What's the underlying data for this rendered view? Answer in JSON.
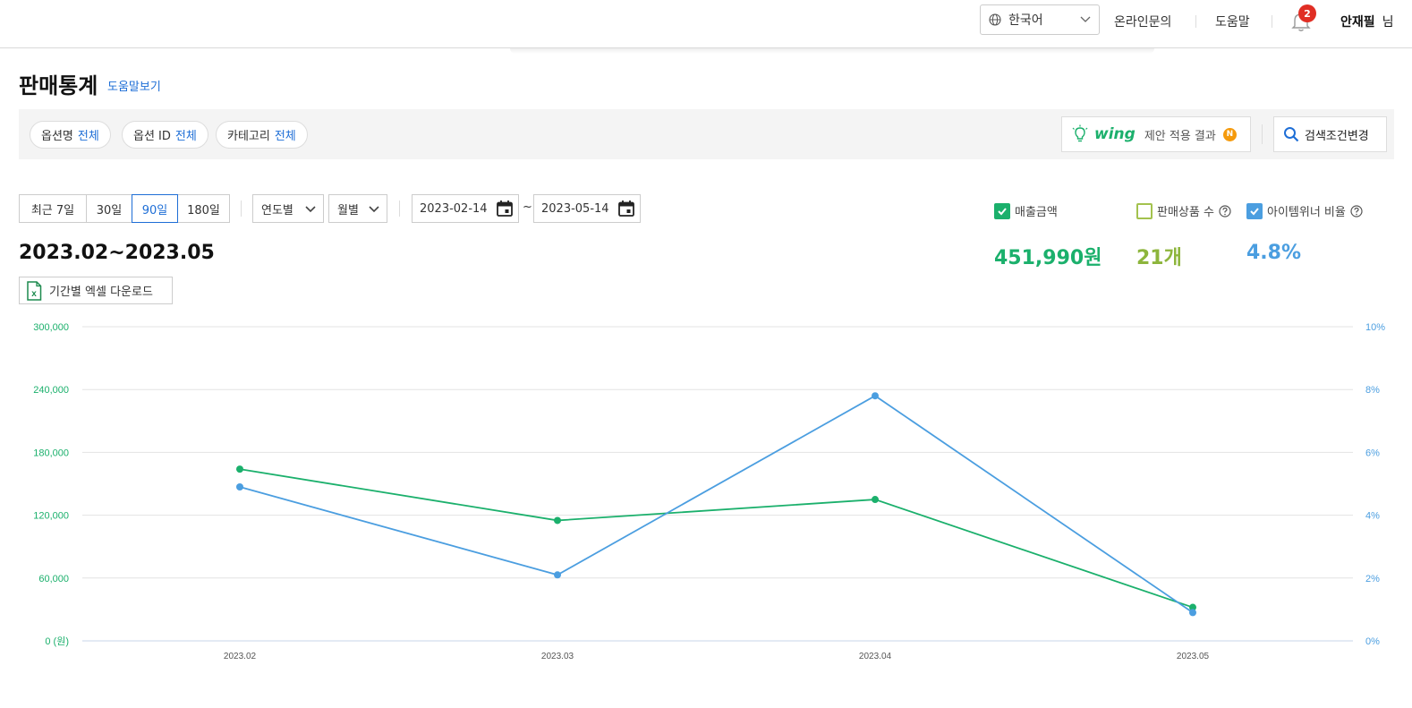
{
  "topbar": {
    "language": "한국어",
    "online_inquiry": "온라인문의",
    "help": "도움말",
    "notification_count": "2",
    "user_name": "안재필",
    "user_suffix": "님"
  },
  "page": {
    "title": "판매통계",
    "help_link": "도움말보기"
  },
  "filters": {
    "option_name_label": "옵션명",
    "option_name_value": "전체",
    "option_id_label": "옵션 ID",
    "option_id_value": "전체",
    "category_label": "카테고리",
    "category_value": "전체",
    "wing_logo": "wing",
    "wing_text": "제안 적용 결과",
    "wing_badge": "N",
    "search_change": "검색조건변경"
  },
  "period": {
    "buttons": [
      "최근 7일",
      "30일",
      "90일",
      "180일"
    ],
    "active_index": 2,
    "year_select": "연도별",
    "month_select": "월별",
    "start_date": "2023-02-14",
    "tilde": "~",
    "end_date": "2023-05-14"
  },
  "summary": {
    "range_title": "2023.02~2023.05",
    "excel_download": "기간별 엑셀 다운로드",
    "legend": {
      "sales_amount": "매출금액",
      "products_sold": "판매상품 수",
      "item_winner_ratio": "아이템위너 비율"
    },
    "sales_amount_value": "451,990원",
    "products_sold_value": "21개",
    "item_winner_ratio_value": "4.8%"
  },
  "colors": {
    "green": "#1bb06c",
    "blue": "#4b9ee0",
    "olive": "#8db53c",
    "link_blue": "#1e6ed6"
  },
  "chart_data": {
    "type": "line",
    "categories": [
      "2023.02",
      "2023.03",
      "2023.04",
      "2023.05"
    ],
    "series": [
      {
        "name": "매출금액",
        "axis": "left",
        "color": "#1bb06c",
        "values": [
          164000,
          115000,
          135000,
          32000
        ]
      },
      {
        "name": "아이템위너 비율",
        "axis": "right",
        "color": "#4b9ee0",
        "values": [
          4.9,
          2.1,
          7.8,
          0.9
        ]
      }
    ],
    "y_left": {
      "min": 0,
      "max": 300000,
      "ticks": [
        "0 (원)",
        "60,000",
        "120,000",
        "180,000",
        "240,000",
        "300,000"
      ]
    },
    "y_right": {
      "min": 0,
      "max": 10,
      "ticks": [
        "0%",
        "2%",
        "4%",
        "6%",
        "8%",
        "10%"
      ]
    },
    "grid": true
  }
}
